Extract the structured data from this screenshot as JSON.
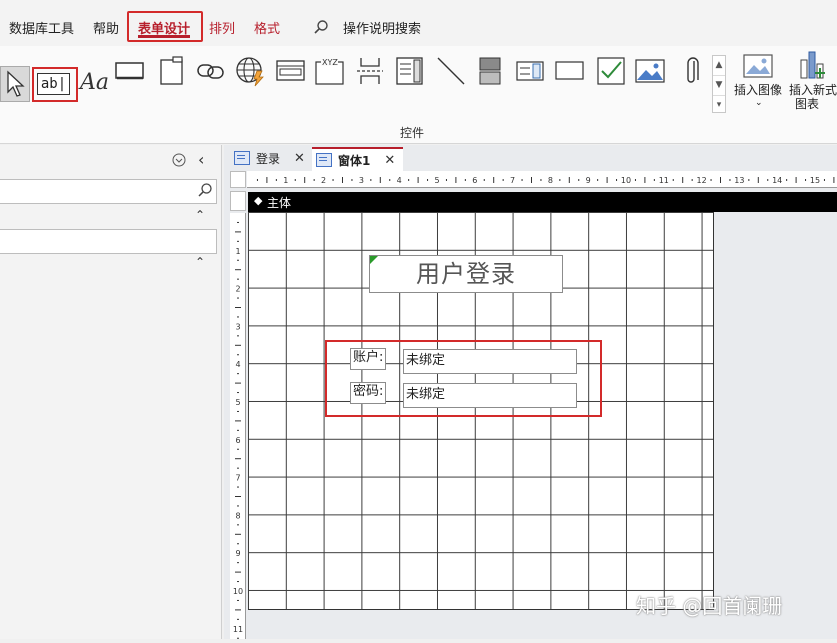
{
  "ribbon": {
    "tabs": [
      {
        "label": "数据库工具"
      },
      {
        "label": "帮助"
      },
      {
        "label": "表单设计"
      },
      {
        "label": "排列"
      },
      {
        "label": "格式"
      }
    ],
    "search_label": "操作说明搜索",
    "textbox_tool_label": "ab|",
    "label_tool_text": "Aa",
    "group_label": "控件",
    "insert_image_label": "插入图像",
    "insert_chart_line1": "插入新式",
    "insert_chart_line2": "图表",
    "colors": {
      "accent_red": "#b71f2c",
      "highlight_box": "#d32a2a"
    }
  },
  "doc_tabs": [
    {
      "label": "登录"
    },
    {
      "label": "窗体1"
    }
  ],
  "ruler": {
    "top_numbers": [
      "1",
      "2",
      "3",
      "4",
      "5",
      "6",
      "7",
      "8",
      "9",
      "10",
      "11",
      "12",
      "13",
      "14",
      "15"
    ],
    "left_numbers": [
      "1",
      "2",
      "3",
      "4",
      "5",
      "6",
      "7",
      "8",
      "9",
      "10",
      "11"
    ]
  },
  "form": {
    "section_label": "主体",
    "title": "用户登录",
    "fields": [
      {
        "label": "账户:",
        "value": "未绑定"
      },
      {
        "label": "密码:",
        "value": "未绑定"
      }
    ]
  },
  "watermark": "知乎 @回首阑珊"
}
